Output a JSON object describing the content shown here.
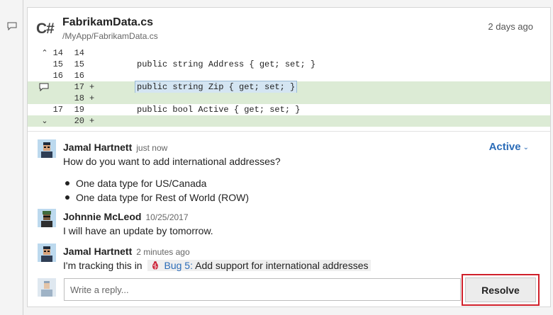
{
  "file": {
    "language_badge": "C#",
    "name": "FabrikamData.cs",
    "path": "/MyApp/FabrikamData.cs",
    "time": "2 days ago"
  },
  "diff": {
    "rows": [
      {
        "old": "14",
        "new": "14",
        "plus": "",
        "code": "",
        "added": false
      },
      {
        "old": "15",
        "new": "15",
        "plus": "",
        "code": "public string Address { get; set; }",
        "added": false
      },
      {
        "old": "16",
        "new": "16",
        "plus": "",
        "code": "",
        "added": false
      },
      {
        "old": "",
        "new": "17",
        "plus": "+",
        "code": "public string Zip { get; set; }",
        "added": true
      },
      {
        "old": "",
        "new": "18",
        "plus": "+",
        "code": "",
        "added": true
      },
      {
        "old": "17",
        "new": "19",
        "plus": "",
        "code": "public bool Active { get; set; }",
        "added": false
      },
      {
        "old": "",
        "new": "20",
        "plus": "+",
        "code": "",
        "added": true
      }
    ]
  },
  "thread": {
    "status": "Active",
    "comments": [
      {
        "author": "Jamal Hartnett",
        "time": "just now",
        "text": "How do you want to add international addresses?",
        "bullets": [
          "One data type for US/Canada",
          "One data type for Rest of World (ROW)"
        ]
      },
      {
        "author": "Johnnie McLeod",
        "time": "10/25/2017",
        "text": "I will have an update by tomorrow."
      },
      {
        "author": "Jamal Hartnett",
        "time": "2 minutes ago",
        "text": "I'm tracking this in",
        "work_item_link": "Bug 5:",
        "work_item_title": "Add support for international addresses"
      }
    ]
  },
  "reply": {
    "placeholder": "Write a reply..."
  },
  "resolve_label": "Resolve",
  "colors": {
    "added_line": "#dcebd5",
    "link": "#2b6cb8",
    "highlight_box": "#d0202a"
  }
}
